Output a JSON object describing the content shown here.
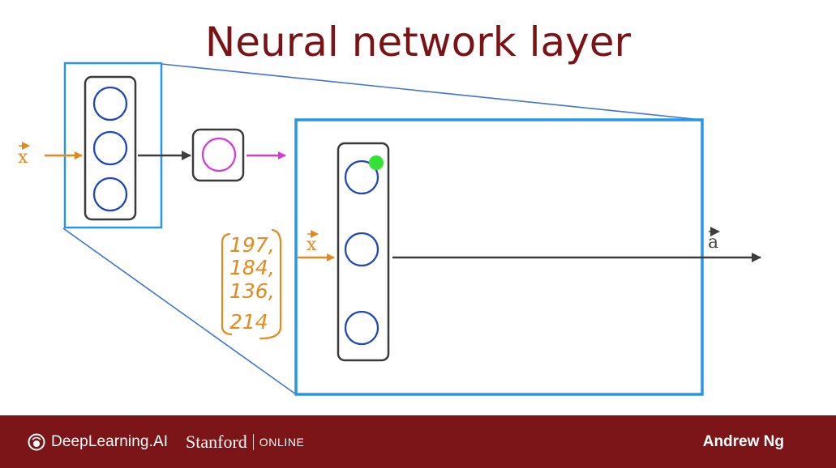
{
  "title": "Neural network layer",
  "labels": {
    "input_small": "x",
    "input_zoom": "x",
    "output": "a"
  },
  "handwritten_input_vector": [
    "197,",
    "184,",
    "136,",
    "214"
  ],
  "footer": {
    "brand": "DeepLearning.AI",
    "partner": "Stanford",
    "partner_suffix": "ONLINE",
    "instructor": "Andrew Ng"
  },
  "colors": {
    "title": "#7a1315",
    "footer_bg": "#7c1517",
    "neuron": "#1f47b6",
    "box_outline": "#3a3a3a",
    "zoom_box": "#2796e6",
    "zoom_lines": "#3f75cf",
    "input_arrow": "#e38a1d",
    "output_neuron": "#d63ad6",
    "pointer": "#33e233",
    "main_arrow": "#3d3d3d"
  }
}
